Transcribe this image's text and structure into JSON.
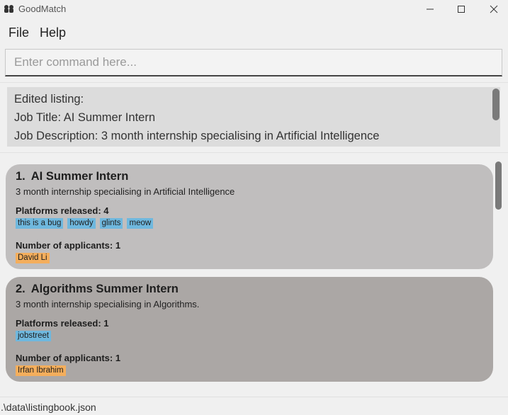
{
  "window": {
    "title": "GoodMatch"
  },
  "menu": {
    "file": "File",
    "help": "Help"
  },
  "command": {
    "placeholder": "Enter command here...",
    "value": ""
  },
  "result": {
    "lines": [
      "Edited listing:",
      "Job Title: AI Summer Intern",
      "Job Description: 3 month internship specialising in Artificial Intelligence"
    ]
  },
  "listings": [
    {
      "index": "1.",
      "title": "AI Summer Intern",
      "description": "3 month internship specialising in Artificial Intelligence",
      "platforms_label": "Platforms released: 4",
      "platforms": [
        "this is a bug",
        "howdy",
        "glints",
        "meow"
      ],
      "applicants_label": "Number of applicants: 1",
      "applicants": [
        "David Li"
      ]
    },
    {
      "index": "2.",
      "title": "Algorithms Summer Intern",
      "description": "3 month internship specialising in Algorithms.",
      "platforms_label": "Platforms released: 1",
      "platforms": [
        "jobstreet"
      ],
      "applicants_label": "Number of applicants: 1",
      "applicants": [
        "Irfan Ibrahim"
      ]
    }
  ],
  "status": {
    "path": ".\\data\\listingbook.json"
  },
  "colors": {
    "card_1": "#c0bebe",
    "card_2": "#aba7a5",
    "platform_tag": "#6fb8de",
    "applicant_tag": "#f4ae5c"
  }
}
